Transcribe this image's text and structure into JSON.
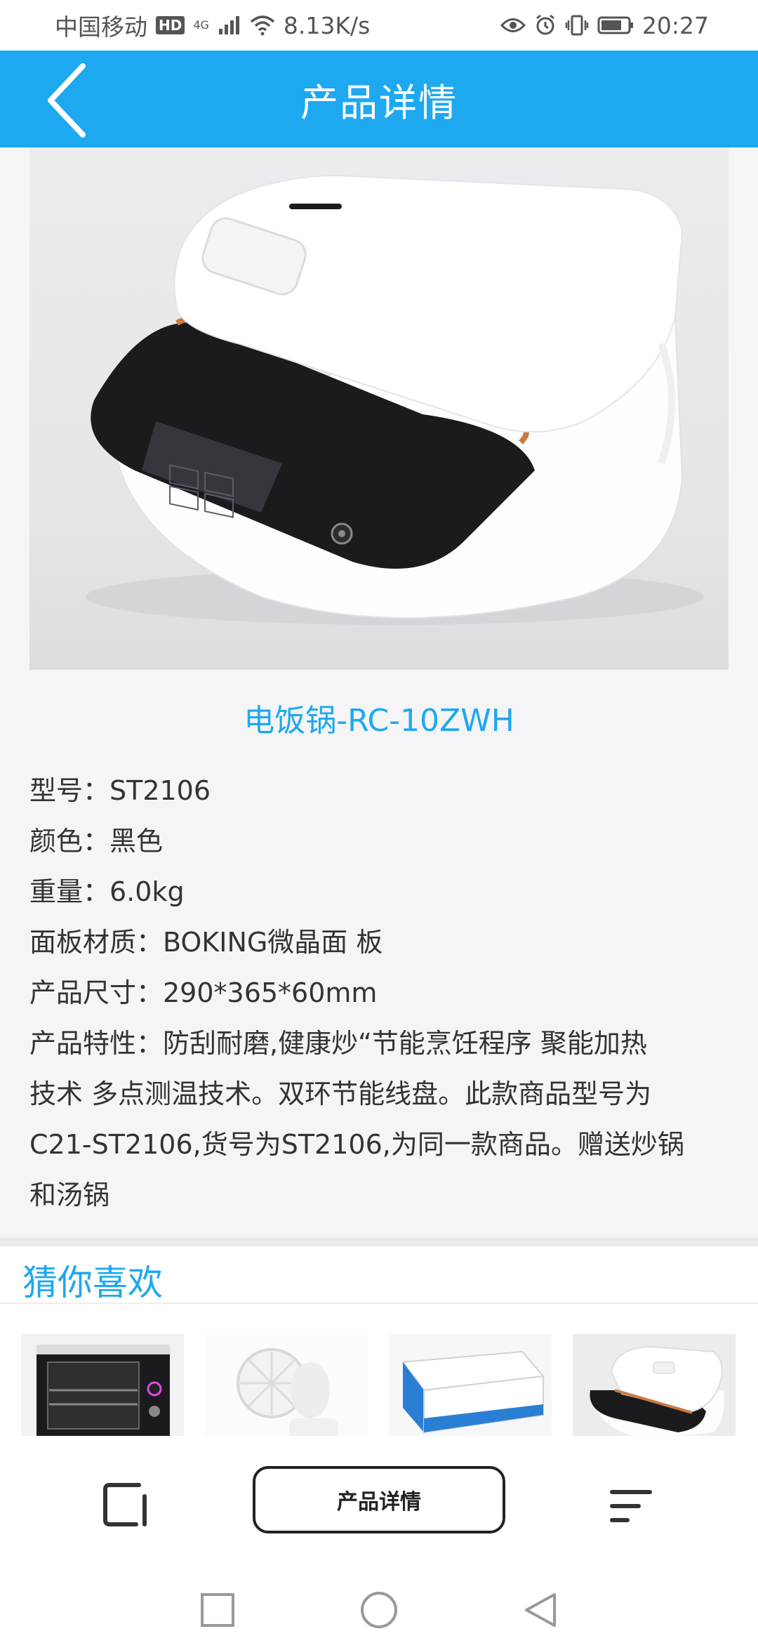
{
  "status_bar": {
    "carrier": "中国移动",
    "hd_badge": "HD",
    "network_type": "4G",
    "speed": "8.13K/s",
    "time": "20:27"
  },
  "header": {
    "title": "产品详情"
  },
  "product": {
    "name": "电饭锅-RC-10ZWH",
    "specs": {
      "model": "型号：ST2106",
      "color": "颜色：黑色",
      "weight": "重量：6.0kg",
      "panel": "面板材质：BOKING微晶面 板",
      "size": "产品尺寸：290*365*60mm",
      "features_line1": "产品特性：防刮耐磨,健康炒“节能烹饪程序 聚能加热",
      "features_line2": "技术 多点测温技术。双环节能线盘。此款商品型号为",
      "features_line3": "C21-ST2106,货号为ST2106,为同一款商品。赠送炒锅",
      "features_line4": "和汤锅"
    }
  },
  "recommend": {
    "title": "猜你喜欢",
    "items": [
      "oven",
      "fan",
      "printer",
      "rice-cooker"
    ]
  },
  "bottom_bar": {
    "center_button": "产品详情"
  },
  "colors": {
    "accent": "#1ea8f0",
    "background": "#f5f5f7"
  }
}
